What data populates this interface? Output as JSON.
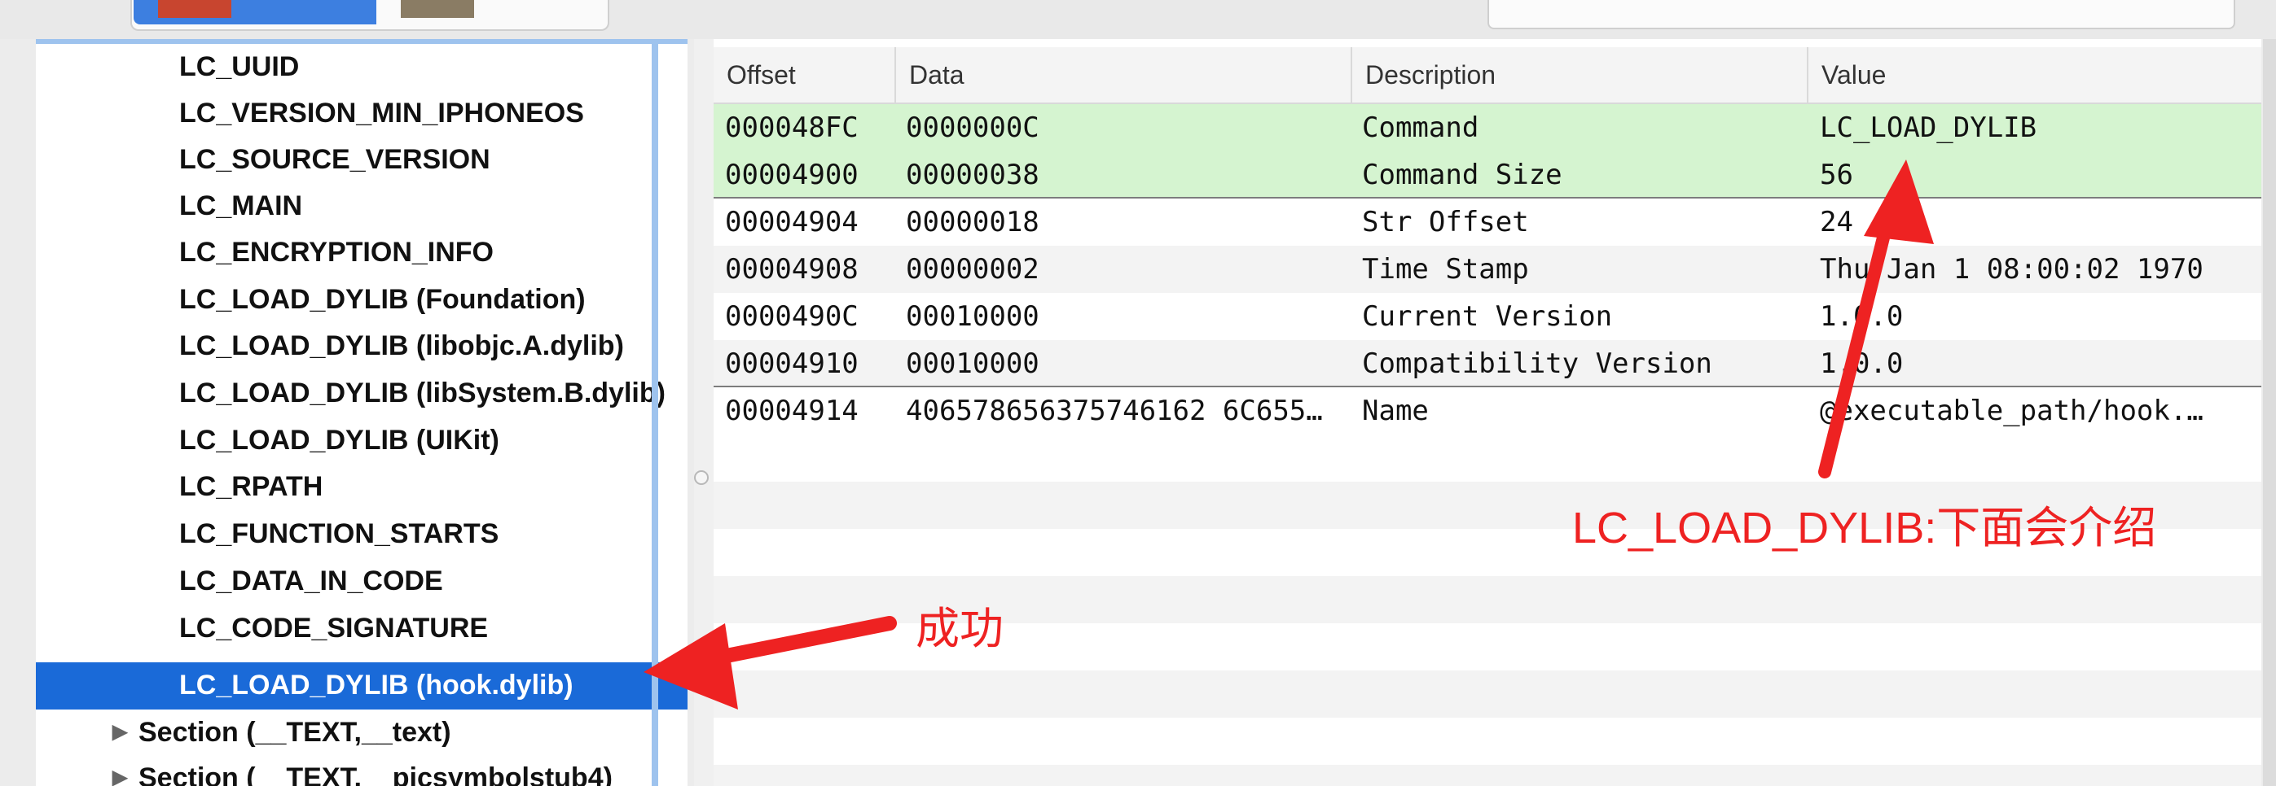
{
  "sidebar": {
    "items": [
      {
        "label": "LC_UUID"
      },
      {
        "label": "LC_VERSION_MIN_IPHONEOS"
      },
      {
        "label": "LC_SOURCE_VERSION"
      },
      {
        "label": "LC_MAIN"
      },
      {
        "label": "LC_ENCRYPTION_INFO"
      },
      {
        "label": "LC_LOAD_DYLIB (Foundation)"
      },
      {
        "label": "LC_LOAD_DYLIB (libobjc.A.dylib)"
      },
      {
        "label": "LC_LOAD_DYLIB (libSystem.B.dylib)"
      },
      {
        "label": "LC_LOAD_DYLIB (UIKit)"
      },
      {
        "label": "LC_RPATH"
      },
      {
        "label": "LC_FUNCTION_STARTS"
      },
      {
        "label": "LC_DATA_IN_CODE"
      },
      {
        "label": "LC_CODE_SIGNATURE"
      },
      {
        "label": "LC_LOAD_DYLIB (hook.dylib)",
        "selected": true
      }
    ],
    "sections": [
      {
        "label": "Section (__TEXT,__text)"
      },
      {
        "label": "Section (__TEXT,__picsymbolstub4)"
      }
    ]
  },
  "table": {
    "columns": [
      "Offset",
      "Data",
      "Description",
      "Value"
    ],
    "rows": [
      {
        "offset": "000048FC",
        "data": "0000000C",
        "description": "Command",
        "value": "LC_LOAD_DYLIB"
      },
      {
        "offset": "00004900",
        "data": "00000038",
        "description": "Command Size",
        "value": "56"
      },
      {
        "offset": "00004904",
        "data": "00000018",
        "description": "Str Offset",
        "value": "24"
      },
      {
        "offset": "00004908",
        "data": "00000002",
        "description": "Time Stamp",
        "value": "Thu Jan  1 08:00:02 1970"
      },
      {
        "offset": "0000490C",
        "data": "00010000",
        "description": "Current Version",
        "value": "1.0.0"
      },
      {
        "offset": "00004910",
        "data": "00010000",
        "description": "Compatibility Version",
        "value": "1.0.0"
      },
      {
        "offset": "00004914",
        "data": "406578656375746162 6C655…",
        "description": "Name",
        "value": "@executable_path/hook.…"
      }
    ]
  },
  "annotations": {
    "success": "成功",
    "dylib_note": "LC_LOAD_DYLIB:下面会介绍",
    "color": "#ee2222"
  },
  "colors": {
    "selection": "#1a6ad8",
    "highlight_rows": "#d5f4d0"
  }
}
